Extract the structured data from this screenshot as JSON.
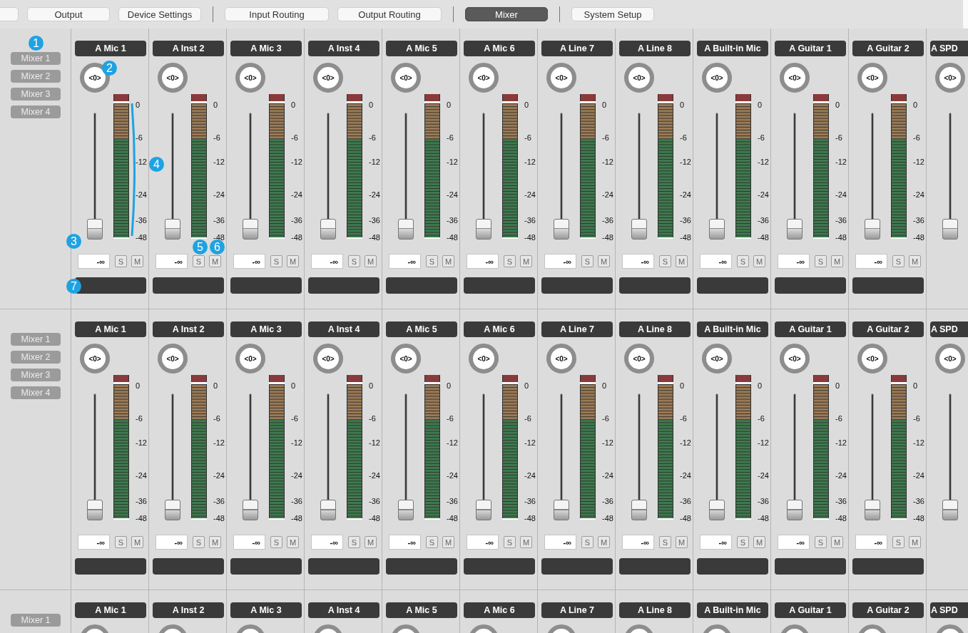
{
  "tabs": [
    {
      "label": "Output",
      "selected": false,
      "divider_before": false
    },
    {
      "label": "Device Settings",
      "selected": false,
      "divider_before": false
    },
    {
      "label": "Input Routing",
      "selected": false,
      "divider_before": true
    },
    {
      "label": "Output Routing",
      "selected": false,
      "divider_before": false
    },
    {
      "label": "Mixer",
      "selected": true,
      "divider_before": true
    },
    {
      "label": "System Setup",
      "selected": false,
      "divider_before": true
    }
  ],
  "mixer_rows": [
    {
      "mixers": [
        "Mixer 1",
        "Mixer 2",
        "Mixer 3",
        "Mixer 4"
      ],
      "channels": [
        {
          "kind": "full",
          "name": "A Mic 1",
          "pan": "<0>",
          "fader": {
            "level": 0
          },
          "scale": [
            "0",
            "-6",
            "-12",
            "-24",
            "-36",
            "-48"
          ],
          "value": "-∞",
          "solo": "S",
          "mute": "M"
        },
        {
          "kind": "full",
          "name": "A Inst 2",
          "pan": "<0>",
          "fader": {
            "level": 0
          },
          "scale": [
            "0",
            "-6",
            "-12",
            "-24",
            "-36",
            "-48"
          ],
          "value": "-∞",
          "solo": "S",
          "mute": "M"
        },
        {
          "kind": "full",
          "name": "A Mic 3",
          "pan": "<0>",
          "fader": {
            "level": 0
          },
          "scale": [
            "0",
            "-6",
            "-12",
            "-24",
            "-36",
            "-48"
          ],
          "value": "-∞",
          "solo": "S",
          "mute": "M"
        },
        {
          "kind": "full",
          "name": "A Inst 4",
          "pan": "<0>",
          "fader": {
            "level": 0
          },
          "scale": [
            "0",
            "-6",
            "-12",
            "-24",
            "-36",
            "-48"
          ],
          "value": "-∞",
          "solo": "S",
          "mute": "M"
        },
        {
          "kind": "full",
          "name": "A Mic 5",
          "pan": "<0>",
          "fader": {
            "level": 0
          },
          "scale": [
            "0",
            "-6",
            "-12",
            "-24",
            "-36",
            "-48"
          ],
          "value": "-∞",
          "solo": "S",
          "mute": "M"
        },
        {
          "kind": "full",
          "name": "A Mic 6",
          "pan": "<0>",
          "fader": {
            "level": 0
          },
          "scale": [
            "0",
            "-6",
            "-12",
            "-24",
            "-36",
            "-48"
          ],
          "value": "-∞",
          "solo": "S",
          "mute": "M"
        },
        {
          "kind": "full",
          "name": "A Line 7",
          "pan": "<0>",
          "fader": {
            "level": 0
          },
          "scale": [
            "0",
            "-6",
            "-12",
            "-24",
            "-36",
            "-48"
          ],
          "value": "-∞",
          "solo": "S",
          "mute": "M"
        },
        {
          "kind": "full",
          "name": "A Line 8",
          "pan": "<0>",
          "fader": {
            "level": 0
          },
          "scale": [
            "0",
            "-6",
            "-12",
            "-24",
            "-36",
            "-48"
          ],
          "value": "-∞",
          "solo": "S",
          "mute": "M"
        },
        {
          "kind": "full",
          "name": "A Built-in Mic",
          "pan": "<0>",
          "fader": {
            "level": 0
          },
          "scale": [
            "0",
            "-6",
            "-12",
            "-24",
            "-36",
            "-48"
          ],
          "value": "-∞",
          "solo": "S",
          "mute": "M"
        },
        {
          "kind": "full",
          "name": "A Guitar 1",
          "pan": "<0>",
          "fader": {
            "level": 0
          },
          "scale": [
            "0",
            "-6",
            "-12",
            "-24",
            "-36",
            "-48"
          ],
          "value": "-∞",
          "solo": "S",
          "mute": "M"
        },
        {
          "kind": "full",
          "name": "A Guitar 2",
          "pan": "<0>",
          "fader": {
            "level": 0
          },
          "scale": [
            "0",
            "-6",
            "-12",
            "-24",
            "-36",
            "-48"
          ],
          "value": "-∞",
          "solo": "S",
          "mute": "M"
        },
        {
          "kind": "cut",
          "name": "A SPD",
          "pan": "<0>",
          "fader": {
            "level": 0
          }
        }
      ]
    },
    {
      "mixers": [
        "Mixer 1",
        "Mixer 2",
        "Mixer 3",
        "Mixer 4"
      ],
      "channels": [
        {
          "kind": "full",
          "name": "A Mic 1",
          "pan": "<0>",
          "fader": {
            "level": 0
          },
          "scale": [
            "0",
            "-6",
            "-12",
            "-24",
            "-36",
            "-48"
          ],
          "value": "-∞",
          "solo": "S",
          "mute": "M"
        },
        {
          "kind": "full",
          "name": "A Inst 2",
          "pan": "<0>",
          "fader": {
            "level": 0
          },
          "scale": [
            "0",
            "-6",
            "-12",
            "-24",
            "-36",
            "-48"
          ],
          "value": "-∞",
          "solo": "S",
          "mute": "M"
        },
        {
          "kind": "full",
          "name": "A Mic 3",
          "pan": "<0>",
          "fader": {
            "level": 0
          },
          "scale": [
            "0",
            "-6",
            "-12",
            "-24",
            "-36",
            "-48"
          ],
          "value": "-∞",
          "solo": "S",
          "mute": "M"
        },
        {
          "kind": "full",
          "name": "A Inst 4",
          "pan": "<0>",
          "fader": {
            "level": 0
          },
          "scale": [
            "0",
            "-6",
            "-12",
            "-24",
            "-36",
            "-48"
          ],
          "value": "-∞",
          "solo": "S",
          "mute": "M"
        },
        {
          "kind": "full",
          "name": "A Mic 5",
          "pan": "<0>",
          "fader": {
            "level": 0
          },
          "scale": [
            "0",
            "-6",
            "-12",
            "-24",
            "-36",
            "-48"
          ],
          "value": "-∞",
          "solo": "S",
          "mute": "M"
        },
        {
          "kind": "full",
          "name": "A Mic 6",
          "pan": "<0>",
          "fader": {
            "level": 0
          },
          "scale": [
            "0",
            "-6",
            "-12",
            "-24",
            "-36",
            "-48"
          ],
          "value": "-∞",
          "solo": "S",
          "mute": "M"
        },
        {
          "kind": "full",
          "name": "A Line 7",
          "pan": "<0>",
          "fader": {
            "level": 0
          },
          "scale": [
            "0",
            "-6",
            "-12",
            "-24",
            "-36",
            "-48"
          ],
          "value": "-∞",
          "solo": "S",
          "mute": "M"
        },
        {
          "kind": "full",
          "name": "A Line 8",
          "pan": "<0>",
          "fader": {
            "level": 0
          },
          "scale": [
            "0",
            "-6",
            "-12",
            "-24",
            "-36",
            "-48"
          ],
          "value": "-∞",
          "solo": "S",
          "mute": "M"
        },
        {
          "kind": "full",
          "name": "A Built-in Mic",
          "pan": "<0>",
          "fader": {
            "level": 0
          },
          "scale": [
            "0",
            "-6",
            "-12",
            "-24",
            "-36",
            "-48"
          ],
          "value": "-∞",
          "solo": "S",
          "mute": "M"
        },
        {
          "kind": "full",
          "name": "A Guitar 1",
          "pan": "<0>",
          "fader": {
            "level": 0
          },
          "scale": [
            "0",
            "-6",
            "-12",
            "-24",
            "-36",
            "-48"
          ],
          "value": "-∞",
          "solo": "S",
          "mute": "M"
        },
        {
          "kind": "full",
          "name": "A Guitar 2",
          "pan": "<0>",
          "fader": {
            "level": 0
          },
          "scale": [
            "0",
            "-6",
            "-12",
            "-24",
            "-36",
            "-48"
          ],
          "value": "-∞",
          "solo": "S",
          "mute": "M"
        },
        {
          "kind": "cut",
          "name": "A SPD",
          "pan": "<0>",
          "fader": {
            "level": 0
          }
        }
      ]
    },
    {
      "mixers": [
        "Mixer 1"
      ],
      "channels": [
        {
          "kind": "top",
          "name": "A Mic 1"
        },
        {
          "kind": "top",
          "name": "A Inst 2"
        },
        {
          "kind": "top",
          "name": "A Mic 3"
        },
        {
          "kind": "top",
          "name": "A Inst 4"
        },
        {
          "kind": "top",
          "name": "A Mic 5"
        },
        {
          "kind": "top",
          "name": "A Mic 6"
        },
        {
          "kind": "top",
          "name": "A Line 7"
        },
        {
          "kind": "top",
          "name": "A Line 8"
        },
        {
          "kind": "top",
          "name": "A Built-in Mic"
        },
        {
          "kind": "top",
          "name": "A Guitar 1"
        },
        {
          "kind": "top",
          "name": "A Guitar 2"
        },
        {
          "kind": "top",
          "name": "A SPD"
        }
      ]
    }
  ],
  "callouts": [
    {
      "label": "1"
    },
    {
      "label": "2"
    },
    {
      "label": "3"
    },
    {
      "label": "4"
    },
    {
      "label": "5"
    },
    {
      "label": "6"
    },
    {
      "label": "7"
    }
  ]
}
